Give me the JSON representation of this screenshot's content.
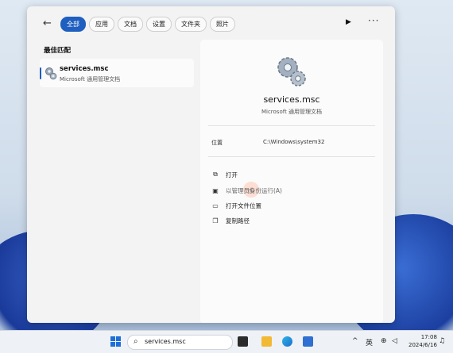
{
  "nav": {
    "back_icon": "arrow-left-icon",
    "chips": [
      "全部",
      "应用",
      "文档",
      "设置",
      "文件夹",
      "照片"
    ],
    "active_chip": "全部",
    "play_icon": "play-icon",
    "more_icon": "more-icon"
  },
  "best_match": {
    "title": "最佳匹配",
    "name": "services.msc",
    "subtitle": "Microsoft 通用管理文档"
  },
  "detail": {
    "name": "services.msc",
    "subtitle": "Microsoft 通用管理文档",
    "location_label": "位置",
    "location_value": "C:\\Windows\\system32",
    "actions": [
      {
        "label": "打开",
        "icon": "open-icon"
      },
      {
        "label": "以管理员身份运行(A)",
        "icon": "admin-icon"
      },
      {
        "label": "打开文件位置",
        "icon": "folder-icon"
      },
      {
        "label": "复制路径",
        "icon": "copy-icon"
      }
    ]
  },
  "taskbar": {
    "search_text": "services.msc",
    "tray_lang": "英",
    "time": "17:08",
    "date": "2024/6/16"
  },
  "colors": {
    "accent": "#1f5fbf"
  }
}
